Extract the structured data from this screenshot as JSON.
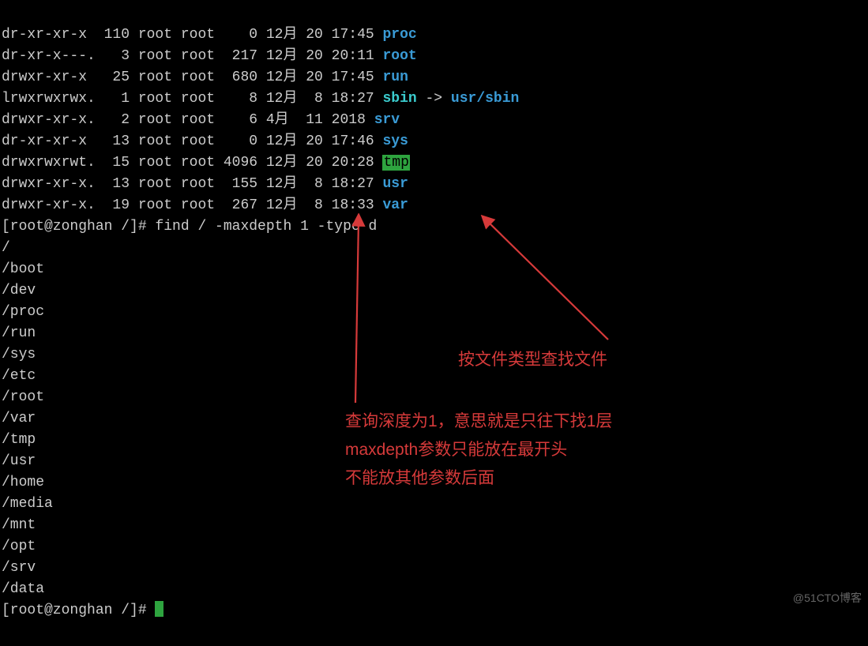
{
  "ls_entries": [
    {
      "perm": "dr-xr-xr-x ",
      "links": "110",
      "owner": "root",
      "group": "root",
      "size": "   0",
      "month": "12月",
      "day": "20",
      "time": "17:45",
      "name": "proc",
      "type": "dir"
    },
    {
      "perm": "dr-xr-x---.",
      "links": "  3",
      "owner": "root",
      "group": "root",
      "size": " 217",
      "month": "12月",
      "day": "20",
      "time": "20:11",
      "name": "root",
      "type": "dir"
    },
    {
      "perm": "drwxr-xr-x ",
      "links": " 25",
      "owner": "root",
      "group": "root",
      "size": " 680",
      "month": "12月",
      "day": "20",
      "time": "17:45",
      "name": "run",
      "type": "dir"
    },
    {
      "perm": "lrwxrwxrwx.",
      "links": "  1",
      "owner": "root",
      "group": "root",
      "size": "   8",
      "month": "12月",
      "day": " 8",
      "time": "18:27",
      "name": "sbin",
      "type": "symlink",
      "target": "usr/sbin"
    },
    {
      "perm": "drwxr-xr-x.",
      "links": "  2",
      "owner": "root",
      "group": "root",
      "size": "   6",
      "month": "4月 ",
      "day": "11",
      "time": "2018",
      "name": "srv",
      "type": "dir"
    },
    {
      "perm": "dr-xr-xr-x ",
      "links": " 13",
      "owner": "root",
      "group": "root",
      "size": "   0",
      "month": "12月",
      "day": "20",
      "time": "17:46",
      "name": "sys",
      "type": "dir"
    },
    {
      "perm": "drwxrwxrwt.",
      "links": " 15",
      "owner": "root",
      "group": "root",
      "size": "4096",
      "month": "12月",
      "day": "20",
      "time": "20:28",
      "name": "tmp",
      "type": "sticky"
    },
    {
      "perm": "drwxr-xr-x.",
      "links": " 13",
      "owner": "root",
      "group": "root",
      "size": " 155",
      "month": "12月",
      "day": " 8",
      "time": "18:27",
      "name": "usr",
      "type": "dir"
    },
    {
      "perm": "drwxr-xr-x.",
      "links": " 19",
      "owner": "root",
      "group": "root",
      "size": " 267",
      "month": "12月",
      "day": " 8",
      "time": "18:33",
      "name": "var",
      "type": "dir"
    }
  ],
  "prompt1": "[root@zonghan /]# ",
  "command1": "find / -maxdepth 1 -type d",
  "find_output": [
    "/",
    "/boot",
    "/dev",
    "/proc",
    "/run",
    "/sys",
    "/etc",
    "/root",
    "/var",
    "/tmp",
    "/usr",
    "/home",
    "/media",
    "/mnt",
    "/opt",
    "/srv",
    "/data"
  ],
  "prompt2": "[root@zonghan /]# ",
  "annotation1": "按文件类型查找文件",
  "annotation2_line1": "查询深度为1，意思就是只往下找1层",
  "annotation2_line2": "maxdepth参数只能放在最开头",
  "annotation2_line3": "不能放其他参数后面",
  "watermark": "@51CTO博客"
}
